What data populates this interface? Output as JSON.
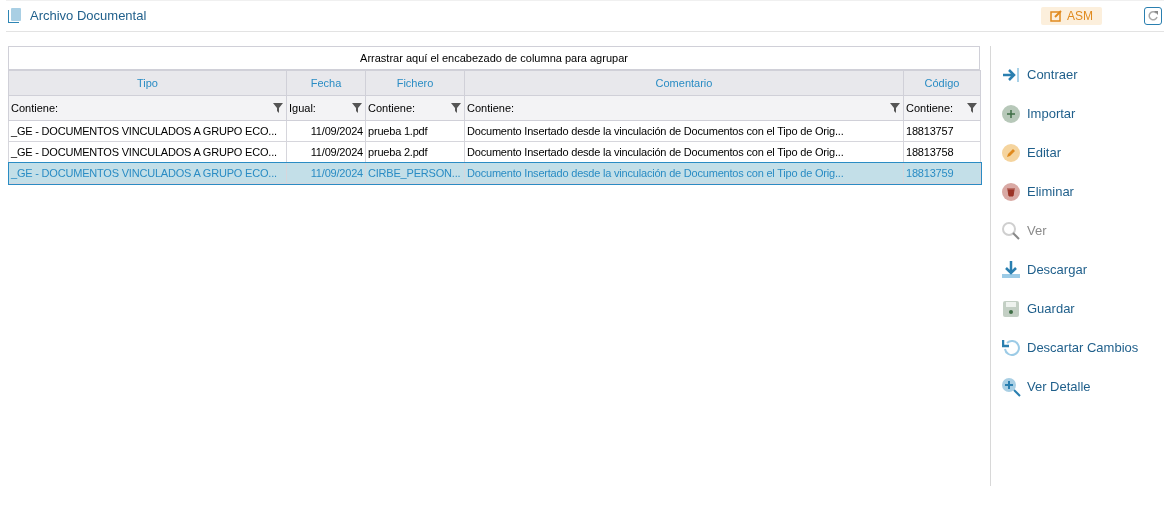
{
  "header": {
    "title": "Archivo Documental",
    "user_badge": "ASM"
  },
  "grid": {
    "group_panel": "Arrastrar aquí el encabezado de columna para agrupar",
    "columns": [
      {
        "kind": "text",
        "label": "Tipo",
        "filter": "Contiene:"
      },
      {
        "kind": "date",
        "label": "Fecha",
        "filter": "Igual:"
      },
      {
        "kind": "text",
        "label": "Fichero",
        "filter": "Contiene:"
      },
      {
        "kind": "text",
        "label": "Comentario",
        "filter": "Contiene:"
      },
      {
        "kind": "text",
        "label": "Código",
        "filter": "Contiene:"
      }
    ],
    "rows": [
      {
        "selected": false,
        "cells": [
          "_GE - DOCUMENTOS VINCULADOS A GRUPO ECO...",
          "11/09/2024",
          "prueba 1.pdf",
          "Documento Insertado desde la vinculación de Documentos con el Tipo de Orig...",
          "18813757"
        ]
      },
      {
        "selected": false,
        "cells": [
          "_GE - DOCUMENTOS VINCULADOS A GRUPO ECO...",
          "11/09/2024",
          "prueba 2.pdf",
          "Documento Insertado desde la vinculación de Documentos con el Tipo de Orig...",
          "18813758"
        ]
      },
      {
        "selected": true,
        "cells": [
          "_GE - DOCUMENTOS VINCULADOS A GRUPO ECO...",
          "11/09/2024",
          "CIRBE_PERSON...",
          "Documento Insertado desde la vinculación de Documentos con el Tipo de Orig...",
          "18813759"
        ]
      }
    ]
  },
  "actions": [
    {
      "kind": "collapse",
      "label": "Contraer",
      "disabled": false
    },
    {
      "kind": "import",
      "label": "Importar",
      "disabled": false
    },
    {
      "kind": "edit",
      "label": "Editar",
      "disabled": false
    },
    {
      "kind": "delete",
      "label": "Eliminar",
      "disabled": false
    },
    {
      "kind": "view",
      "label": "Ver",
      "disabled": true
    },
    {
      "kind": "download",
      "label": "Descargar",
      "disabled": false
    },
    {
      "kind": "save",
      "label": "Guardar",
      "disabled": false
    },
    {
      "kind": "discard",
      "label": "Descartar Cambios",
      "disabled": false
    },
    {
      "kind": "detail",
      "label": "Ver Detalle",
      "disabled": false
    }
  ]
}
